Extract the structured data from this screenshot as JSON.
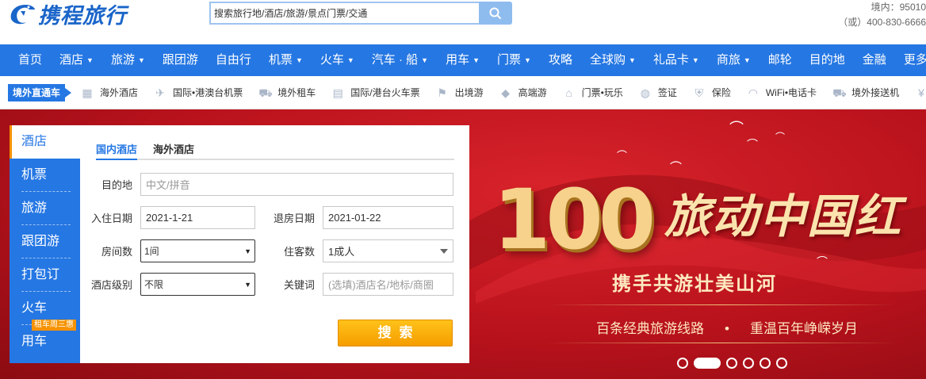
{
  "header": {
    "logo_text": "携程旅行",
    "search_placeholder": "搜索旅行地/酒店/旅游/景点门票/交通",
    "hotline_line1": "境内：95010",
    "hotline_line2": "（或）400-830-6666"
  },
  "nav": {
    "items": [
      {
        "label": "首页",
        "caret": false
      },
      {
        "label": "酒店",
        "caret": true
      },
      {
        "label": "旅游",
        "caret": true
      },
      {
        "label": "跟团游",
        "caret": false
      },
      {
        "label": "自由行",
        "caret": false
      },
      {
        "label": "机票",
        "caret": true
      },
      {
        "label": "火车",
        "caret": true
      },
      {
        "label": "汽车 · 船",
        "caret": true
      },
      {
        "label": "用车",
        "caret": true
      },
      {
        "label": "门票",
        "caret": true
      },
      {
        "label": "攻略",
        "caret": false
      },
      {
        "label": "全球购",
        "caret": true
      },
      {
        "label": "礼品卡",
        "caret": true
      },
      {
        "label": "商旅",
        "caret": true
      },
      {
        "label": "邮轮",
        "caret": false
      },
      {
        "label": "目的地",
        "caret": false
      },
      {
        "label": "金融",
        "caret": false
      },
      {
        "label": "更多",
        "caret": false
      }
    ],
    "caret_glyph": "▼"
  },
  "subnav": {
    "tag": "境外直通车",
    "items": [
      {
        "label": "海外酒店",
        "icon": "hotel-icon",
        "glyph": "▦"
      },
      {
        "label": "国际•港澳台机票",
        "icon": "plane-icon",
        "glyph": "✈"
      },
      {
        "label": "境外租车",
        "icon": "car-icon",
        "glyph": "⛟"
      },
      {
        "label": "国际/港台火车票",
        "icon": "train-icon",
        "glyph": "▤"
      },
      {
        "label": "出境游",
        "icon": "flag-icon",
        "glyph": "⚑"
      },
      {
        "label": "高端游",
        "icon": "diamond-icon",
        "glyph": "◆"
      },
      {
        "label": "门票•玩乐",
        "icon": "temple-icon",
        "glyph": "⌂"
      },
      {
        "label": "签证",
        "icon": "globe-icon",
        "glyph": "◍"
      },
      {
        "label": "保险",
        "icon": "shield-icon",
        "glyph": "⛨"
      },
      {
        "label": "WiFi•电话卡",
        "icon": "wifi-icon",
        "glyph": "◠"
      },
      {
        "label": "境外接送机",
        "icon": "shuttle-icon",
        "glyph": "⛟"
      },
      {
        "label": "外币兑换",
        "icon": "currency-icon",
        "glyph": "¥"
      }
    ]
  },
  "booking": {
    "side_tabs": [
      "酒店",
      "机票",
      "旅游",
      "跟团游",
      "打包订",
      "火车",
      "用车"
    ],
    "promo_badge": "租车周三惠",
    "tabs": [
      "国内酒店",
      "海外酒店"
    ],
    "fields": {
      "destination_label": "目的地",
      "destination_placeholder": "中文/拼音",
      "checkin_label": "入住日期",
      "checkin_value": "2021-1-21",
      "checkout_label": "退房日期",
      "checkout_value": "2021-01-22",
      "rooms_label": "房间数",
      "rooms_value": "1间",
      "guests_label": "住客数",
      "guests_value": "1成人",
      "star_label": "酒店级别",
      "star_value": "不限",
      "keyword_label": "关键词",
      "keyword_placeholder": "(选填)酒店名/地标/商圈"
    },
    "search_button": "搜索"
  },
  "banner": {
    "number": "100",
    "title": "旅动中国红",
    "subtitle": "携手共游壮美山河",
    "desc_left": "百条经典旅游线路",
    "desc_sep": "•",
    "desc_right": "重温百年峥嵘岁月",
    "slide_count": 6,
    "active_slide": 2
  },
  "colors": {
    "brand_blue": "#2577e3",
    "accent_orange": "#f59200",
    "banner_red": "#c4141d"
  }
}
